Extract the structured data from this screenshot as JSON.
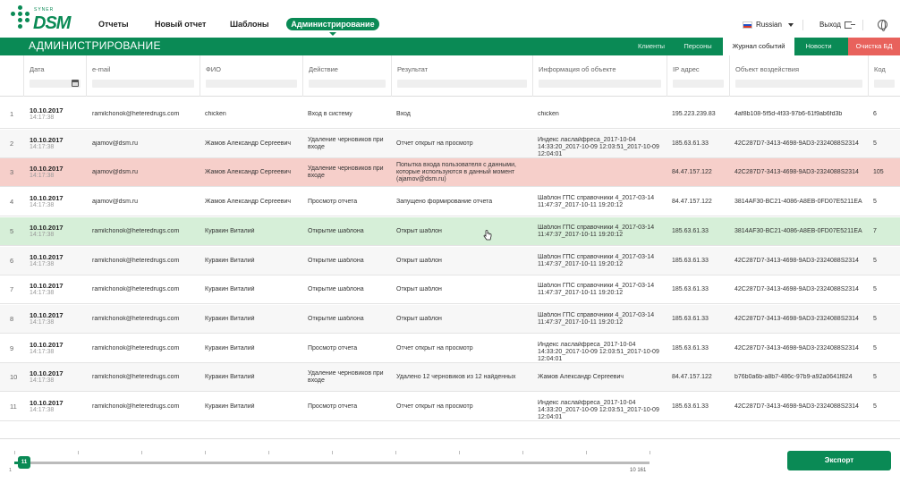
{
  "brand": {
    "sub": "SYNER",
    "name": "DSM"
  },
  "nav": {
    "items": [
      "Отчеты",
      "Новый отчет",
      "Шаблоны"
    ],
    "active": "Администрирование",
    "language": "Russian",
    "logout": "Выход"
  },
  "admin": {
    "title": "АДМИНИСТРИРОВАНИЕ",
    "tabs": [
      "Клиенты",
      "Персоны",
      "Журнал событий",
      "Новости",
      "Очистка БД"
    ],
    "active_tab": "Журнал событий"
  },
  "columns": [
    "Дата",
    "e-mail",
    "ФИО",
    "Действие",
    "Результат",
    "Информация об объекте",
    "IP адрес",
    "Объект воздействия",
    "Код"
  ],
  "rows": [
    {
      "num": "1",
      "date": "10.10.2017",
      "time": "14:17:38",
      "email": "ramilchonok@heteredrugs.com",
      "fio": "chicken",
      "action": "Вход в систему",
      "result": "Вход",
      "info": "chicken",
      "ip": "195.223.239.83",
      "object": "4af8b108-5f5d-4f33-97b6-61f9ab6fd3b",
      "code": "6",
      "style": ""
    },
    {
      "num": "2",
      "date": "10.10.2017",
      "time": "14:17:38",
      "email": "ajamov@dsm.ru",
      "fio": "Жамов Александр Сергеевич",
      "action": "Удаление черновиков при входе",
      "result": "Отчет открыт на просмотр",
      "info": "Индекс ласлайфреса_2017-10-04 14:33:20_2017-10-09 12:03:51_2017-10-09 12:04:01",
      "ip": "185.63.61.33",
      "object": "42C287D7-3413-4698-9AD3-2324088S2314",
      "code": "5",
      "style": "alt"
    },
    {
      "num": "3",
      "date": "10.10.2017",
      "time": "14:17:38",
      "email": "ajamov@dsm.ru",
      "fio": "Жамов Александр Сергеевич",
      "action": "Удаление черновиков при входе",
      "result": "Попытка входа пользователя с данными, которые используются в данный момент (ajamov@dsm.ru)",
      "info": "",
      "ip": "84.47.157.122",
      "object": "42C287D7-3413-4698-9AD3-2324088S2314",
      "code": "105",
      "style": "red"
    },
    {
      "num": "4",
      "date": "10.10.2017",
      "time": "14:17:38",
      "email": "ajamov@dsm.ru",
      "fio": "Жамов Александр Сергеевич",
      "action": "Просмотр отчета",
      "result": "Запущено формирование отчета",
      "info": "Шаблон ГПС справочники 4_2017-03-14 11:47:37_2017-10-11 19:20:12",
      "ip": "84.47.157.122",
      "object": "3814AF30-BC21-4086-A8EB-0FD07E5211EA",
      "code": "5",
      "style": ""
    },
    {
      "num": "5",
      "date": "10.10.2017",
      "time": "14:17:38",
      "email": "ramilchonok@heteredrugs.com",
      "fio": "Куракин Виталий",
      "action": "Открытие шаблона",
      "result": "Открыт шаблон",
      "info": "Шаблон ГПС справочники 4_2017-03-14 11:47:37_2017-10-11 19:20:12",
      "ip": "185.63.61.33",
      "object": "3814AF30-BC21-4086-A8EB-0FD07E5211EA",
      "code": "7",
      "style": "green"
    },
    {
      "num": "6",
      "date": "10.10.2017",
      "time": "14:17:38",
      "email": "ramilchonok@heteredrugs.com",
      "fio": "Куракин Виталий",
      "action": "Открытие шаблона",
      "result": "Открыт шаблон",
      "info": "Шаблон ГПС справочники 4_2017-03-14 11:47:37_2017-10-11 19:20:12",
      "ip": "185.63.61.33",
      "object": "42C287D7-3413-4698-9AD3-2324088S2314",
      "code": "5",
      "style": "alt"
    },
    {
      "num": "7",
      "date": "10.10.2017",
      "time": "14:17:38",
      "email": "ramilchonok@heteredrugs.com",
      "fio": "Куракин Виталий",
      "action": "Открытие шаблона",
      "result": "Открыт шаблон",
      "info": "Шаблон ГПС справочники 4_2017-03-14 11:47:37_2017-10-11 19:20:12",
      "ip": "185.63.61.33",
      "object": "42C287D7-3413-4698-9AD3-2324088S2314",
      "code": "5",
      "style": ""
    },
    {
      "num": "8",
      "date": "10.10.2017",
      "time": "14:17:38",
      "email": "ramilchonok@heteredrugs.com",
      "fio": "Куракин Виталий",
      "action": "Открытие шаблона",
      "result": "Открыт шаблон",
      "info": "Шаблон ГПС справочники 4_2017-03-14 11:47:37_2017-10-11 19:20:12",
      "ip": "185.63.61.33",
      "object": "42C287D7-3413-4698-9AD3-2324088S2314",
      "code": "5",
      "style": "alt"
    },
    {
      "num": "9",
      "date": "10.10.2017",
      "time": "14:17:38",
      "email": "ramilchonok@heteredrugs.com",
      "fio": "Куракин Виталий",
      "action": "Просмотр отчета",
      "result": "Отчет открыт на просмотр",
      "info": "Индекс ласлайфреса_2017-10-04 14:33:20_2017-10-09 12:03:51_2017-10-09 12:04:01",
      "ip": "185.63.61.33",
      "object": "42C287D7-3413-4698-9AD3-2324088S2314",
      "code": "5",
      "style": ""
    },
    {
      "num": "10",
      "date": "10.10.2017",
      "time": "14:17:38",
      "email": "ramilchonok@heteredrugs.com",
      "fio": "Куракин Виталий",
      "action": "Удаление черновиков при входе",
      "result": "Удалено 12 черновиков из 12 найденных",
      "info": "Жамов Александр Сергеевич",
      "ip": "84.47.157.122",
      "object": "b76b0a6b-a8b7-486c-97b9-a92a0641f824",
      "code": "5",
      "style": "alt"
    },
    {
      "num": "11",
      "date": "10.10.2017",
      "time": "14:17:38",
      "email": "ramilchonok@heteredrugs.com",
      "fio": "Куракин Виталий",
      "action": "Просмотр отчета",
      "result": "Отчет открыт на просмотр",
      "info": "Индекс ласлайфреса_2017-10-04 14:33:20_2017-10-09 12:03:51_2017-10-09 12:04:01",
      "ip": "185.63.61.33",
      "object": "42C287D7-3413-4698-9AD3-2324088S2314",
      "code": "5",
      "style": ""
    }
  ],
  "pager": {
    "min_label": "1",
    "handle_label": "11",
    "max_label": "10 161"
  },
  "export_label": "Экспорт",
  "colors": {
    "brand": "#0a8a55",
    "danger": "#e8625c",
    "error_row": "#f6cfca",
    "selected_row": "#d6efd8"
  }
}
